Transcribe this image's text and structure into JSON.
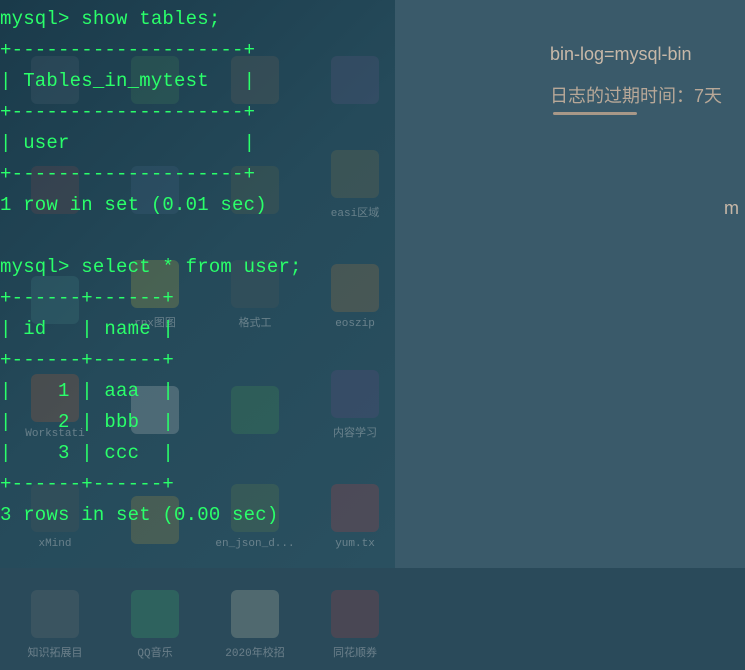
{
  "terminal": {
    "prompt": "mysql>",
    "query1": "show tables;",
    "table1": {
      "border": "+--------------------+",
      "header_row": "| Tables_in_mytest   |",
      "data_row": "| user               |"
    },
    "result1": "1 row in set (0.01 sec)",
    "query2": "select * from user;",
    "table2": {
      "border": "+------+------+",
      "header": "| id   | name |",
      "rows": [
        "|    1 | aaa  |",
        "|    2 | bbb  |",
        "|    3 | ccc  |"
      ]
    },
    "result2": "3 rows in set (0.00 sec)"
  },
  "chart_data": {
    "type": "table",
    "title": "user",
    "columns": [
      "id",
      "name"
    ],
    "rows": [
      [
        1,
        "aaa"
      ],
      [
        2,
        "bbb"
      ],
      [
        3,
        "ccc"
      ]
    ]
  },
  "right": {
    "line1": "bin-log=mysql-bin",
    "line2": "日志的过期时间：7天",
    "corner": "m"
  },
  "desktop_labels": {
    "r1c1": "",
    "r1c2": "",
    "r1c3": "",
    "r1c4": "",
    "r2c1": "",
    "r2c2": "",
    "r2c3": "",
    "r2c4": "easi区域",
    "r3c1": "",
    "r3c2": "rpx图图",
    "r3c3": "格式工",
    "r3c4": "eoszip",
    "r4c1": "Workstati",
    "r4c2": "",
    "r4c3": "",
    "r4c4": "内容学习",
    "r5c1": "xMind",
    "r5c2": "",
    "r5c3": "en_json_d...",
    "r5c4": "yum.tx",
    "r6c1": "知识拓展目",
    "r6c2": "QQ音乐",
    "r6c3": "2020年校招",
    "r6c4": "同花顺券"
  }
}
